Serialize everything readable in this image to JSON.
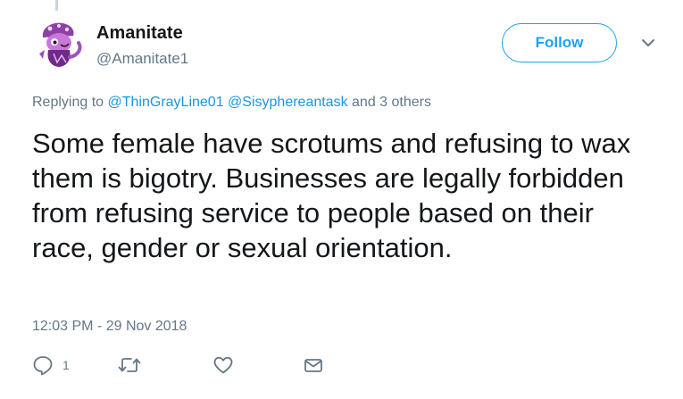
{
  "user": {
    "display_name": "Amanitate",
    "handle": "@Amanitate1",
    "avatar_icon": "purple-creature-avatar"
  },
  "header": {
    "follow_label": "Follow",
    "caret_icon": "chevron-down-icon"
  },
  "reply_context": {
    "prefix": "Replying to",
    "mention_1": "@ThinGrayLine01",
    "mention_2": "@Sisyphereantask",
    "suffix": "and 3 others"
  },
  "tweet": {
    "text": "Some female have scrotums and refusing to wax them is bigotry. Businesses are legally forbidden from refusing service to people based on their race, gender or sexual orientation.",
    "timestamp": "12:03 PM - 29 Nov 2018"
  },
  "actions": {
    "reply_count": "1",
    "reply_icon": "reply-icon",
    "retweet_icon": "retweet-icon",
    "like_icon": "heart-icon",
    "dm_icon": "envelope-icon"
  },
  "colors": {
    "accent": "#1da1f2",
    "muted": "#657786",
    "text": "#14171a"
  }
}
